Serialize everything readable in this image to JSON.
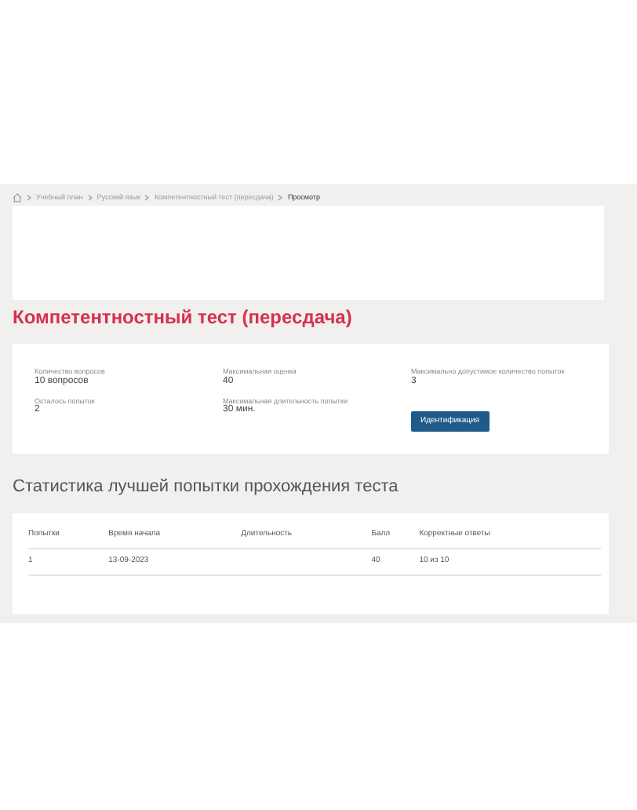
{
  "breadcrumb": [
    "Учебный план",
    "Русский язык",
    "Компетентностный тест (пересдача)",
    "Просмотр"
  ],
  "title": "Компетентностный тест (пересдача)",
  "info": [
    {
      "label": "Количество вопросов",
      "value": "10 вопросов"
    },
    {
      "label": "Максимальная оценка",
      "value": "40"
    },
    {
      "label": "Максимально допустимое количество попыток",
      "value": "3"
    },
    {
      "label": "Осталось попыток",
      "value": "2"
    },
    {
      "label": "Максимальная длительность попытки",
      "value": "30 мин."
    }
  ],
  "identify_button": "Идентификация",
  "stats_title": "Статистика лучшей попытки прохождения теста",
  "table": {
    "columns": [
      "Попытки",
      "Время начала",
      "Длительность",
      "Балл",
      "Корректные ответы"
    ],
    "rows": [
      [
        "1",
        "13-09-2023",
        "",
        "40",
        "10 из 10"
      ]
    ]
  }
}
